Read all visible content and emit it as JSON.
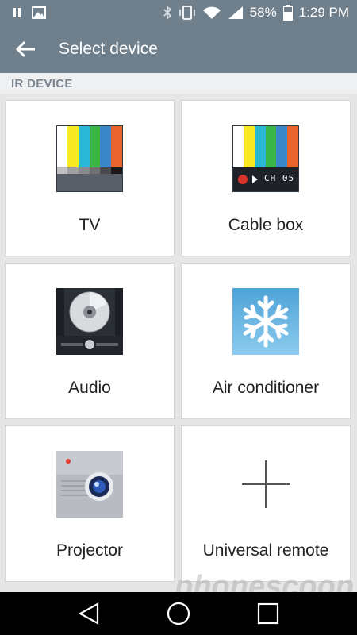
{
  "status_bar": {
    "battery_percent": "58%",
    "time": "1:29 PM"
  },
  "app_bar": {
    "title": "Select device"
  },
  "section": {
    "header": "IR DEVICE"
  },
  "devices": [
    {
      "label": "TV",
      "icon": "tv-icon"
    },
    {
      "label": "Cable box",
      "icon": "cable-box-icon",
      "display_text": "CH 05"
    },
    {
      "label": "Audio",
      "icon": "audio-icon"
    },
    {
      "label": "Air conditioner",
      "icon": "air-conditioner-icon"
    },
    {
      "label": "Projector",
      "icon": "projector-icon"
    },
    {
      "label": "Universal remote",
      "icon": "plus-icon"
    }
  ],
  "watermark": "phonescoop",
  "colors": {
    "app_bar": "#6f7f8c",
    "accent_ac": "#5aa7d6",
    "nav_bar": "#000000"
  }
}
